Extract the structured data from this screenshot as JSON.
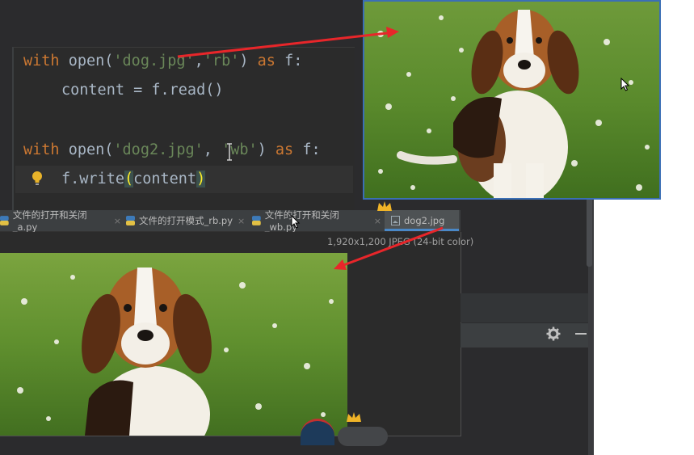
{
  "code": {
    "line1": {
      "kw_with": "with",
      "fn_open": "open(",
      "str_file": "'dog.jpg'",
      "sep": ",",
      "str_mode": "'rb'",
      "close": ")",
      "kw_as": "as",
      "var": "f:"
    },
    "line2": {
      "text": "content = f.read()"
    },
    "line3": {
      "kw_with": "with",
      "fn_open": "open(",
      "str_file": "'dog2.jpg'",
      "sep": ",",
      "str_mode": "'wb'",
      "close": ")",
      "kw_as": "as",
      "var": "f:"
    },
    "line4": {
      "pre": "f.write",
      "lparen": "(",
      "arg": "content",
      "rparen": ")"
    }
  },
  "tabs": [
    {
      "label": "文件的打开和关闭_a.py",
      "icon": "python-file-icon",
      "close": "×"
    },
    {
      "label": "文件的打开模式_rb.py",
      "icon": "python-file-icon",
      "close": "×"
    },
    {
      "label": "文件的打开和关闭_wb.py",
      "icon": "python-file-icon",
      "close": "×"
    },
    {
      "label": "dog2.jpg",
      "icon": "image-file-icon",
      "active": true
    }
  ],
  "viewer": {
    "info": "1,920x1,200 JPEG (24-bit color)"
  },
  "colors": {
    "accent": "#4a88c7",
    "arrow": "#e8262a",
    "keyword": "#cc7832",
    "string": "#6a8759"
  },
  "icons": [
    "lightbulb-icon",
    "gear-icon",
    "minimize-icon",
    "crown-icon",
    "arrow-cursor-icon"
  ]
}
